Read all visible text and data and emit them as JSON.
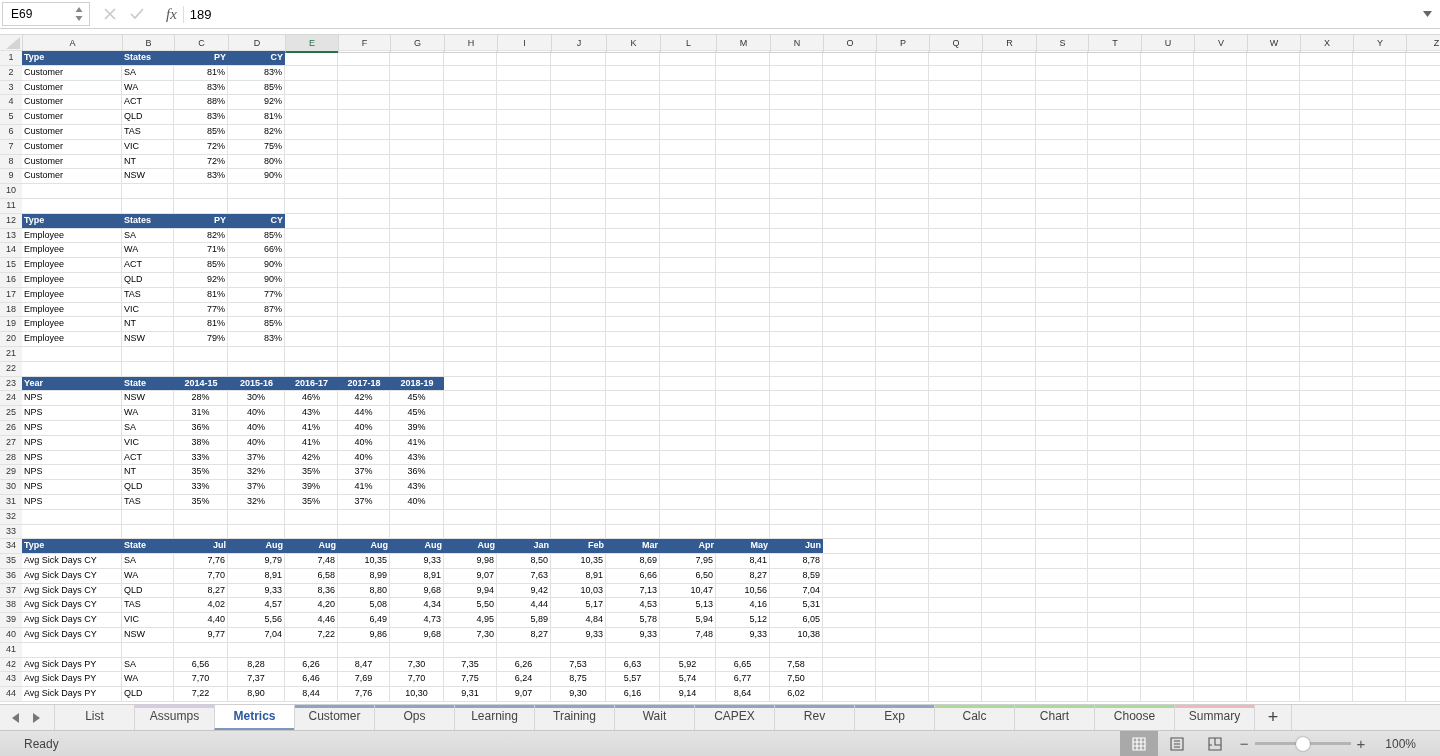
{
  "formula_bar": {
    "name_box": "E69",
    "function_label": "fx",
    "formula": "189"
  },
  "columns": [
    {
      "label": "A",
      "selected": false
    },
    {
      "label": "B",
      "selected": false
    },
    {
      "label": "C",
      "selected": false
    },
    {
      "label": "D",
      "selected": false
    },
    {
      "label": "E",
      "selected": true
    },
    {
      "label": "F",
      "selected": false
    },
    {
      "label": "G",
      "selected": false
    },
    {
      "label": "H",
      "selected": false
    },
    {
      "label": "I",
      "selected": false
    },
    {
      "label": "J",
      "selected": false
    },
    {
      "label": "K",
      "selected": false
    },
    {
      "label": "L",
      "selected": false
    },
    {
      "label": "M",
      "selected": false
    },
    {
      "label": "N",
      "selected": false
    },
    {
      "label": "O",
      "selected": false
    },
    {
      "label": "P",
      "selected": false
    },
    {
      "label": "Q",
      "selected": false
    },
    {
      "label": "R",
      "selected": false
    },
    {
      "label": "S",
      "selected": false
    },
    {
      "label": "T",
      "selected": false
    },
    {
      "label": "U",
      "selected": false
    },
    {
      "label": "V",
      "selected": false
    },
    {
      "label": "W",
      "selected": false
    },
    {
      "label": "X",
      "selected": false
    },
    {
      "label": "Y",
      "selected": false
    },
    {
      "label": "Z",
      "selected": false
    }
  ],
  "rows": [
    {
      "number": "1",
      "kind": "header",
      "cells": [
        "Type",
        "States",
        "PY",
        "CY"
      ]
    },
    {
      "number": "2",
      "kind": "data",
      "cells": [
        "Customer",
        "SA",
        "81%",
        "83%"
      ]
    },
    {
      "number": "3",
      "kind": "data",
      "cells": [
        "Customer",
        "WA",
        "83%",
        "85%"
      ]
    },
    {
      "number": "4",
      "kind": "data",
      "cells": [
        "Customer",
        "ACT",
        "88%",
        "92%"
      ]
    },
    {
      "number": "5",
      "kind": "data",
      "cells": [
        "Customer",
        "QLD",
        "83%",
        "81%"
      ]
    },
    {
      "number": "6",
      "kind": "data",
      "cells": [
        "Customer",
        "TAS",
        "85%",
        "82%"
      ]
    },
    {
      "number": "7",
      "kind": "data",
      "cells": [
        "Customer",
        "VIC",
        "72%",
        "75%"
      ]
    },
    {
      "number": "8",
      "kind": "data",
      "cells": [
        "Customer",
        "NT",
        "72%",
        "80%"
      ]
    },
    {
      "number": "9",
      "kind": "data",
      "cells": [
        "Customer",
        "NSW",
        "83%",
        "90%"
      ]
    },
    {
      "number": "10",
      "cells": []
    },
    {
      "number": "11",
      "cells": []
    },
    {
      "number": "12",
      "kind": "header",
      "cells": [
        "Type",
        "States",
        "PY",
        "CY"
      ]
    },
    {
      "number": "13",
      "kind": "data",
      "cells": [
        "Employee",
        "SA",
        "82%",
        "85%"
      ]
    },
    {
      "number": "14",
      "kind": "data",
      "cells": [
        "Employee",
        "WA",
        "71%",
        "66%"
      ]
    },
    {
      "number": "15",
      "kind": "data",
      "cells": [
        "Employee",
        "ACT",
        "85%",
        "90%"
      ]
    },
    {
      "number": "16",
      "kind": "data",
      "cells": [
        "Employee",
        "QLD",
        "92%",
        "90%"
      ]
    },
    {
      "number": "17",
      "kind": "data",
      "cells": [
        "Employee",
        "TAS",
        "81%",
        "77%"
      ]
    },
    {
      "number": "18",
      "kind": "data",
      "cells": [
        "Employee",
        "VIC",
        "77%",
        "87%"
      ]
    },
    {
      "number": "19",
      "kind": "data",
      "cells": [
        "Employee",
        "NT",
        "81%",
        "85%"
      ]
    },
    {
      "number": "20",
      "kind": "data",
      "cells": [
        "Employee",
        "NSW",
        "79%",
        "83%"
      ]
    },
    {
      "number": "21",
      "cells": []
    },
    {
      "number": "22",
      "cells": []
    },
    {
      "number": "23",
      "kind": "header-centered",
      "cells": [
        "Year",
        "State",
        "2014-15",
        "2015-16",
        "2016-17",
        "2017-18",
        "2018-19"
      ]
    },
    {
      "number": "24",
      "kind": "centered",
      "cells": [
        "NPS",
        "NSW",
        "28%",
        "30%",
        "46%",
        "42%",
        "45%"
      ]
    },
    {
      "number": "25",
      "kind": "centered",
      "cells": [
        "NPS",
        "WA",
        "31%",
        "40%",
        "43%",
        "44%",
        "45%"
      ]
    },
    {
      "number": "26",
      "kind": "centered",
      "cells": [
        "NPS",
        "SA",
        "36%",
        "40%",
        "41%",
        "40%",
        "39%"
      ]
    },
    {
      "number": "27",
      "kind": "centered",
      "cells": [
        "NPS",
        "VIC",
        "38%",
        "40%",
        "41%",
        "40%",
        "41%"
      ]
    },
    {
      "number": "28",
      "kind": "centered",
      "cells": [
        "NPS",
        "ACT",
        "33%",
        "37%",
        "42%",
        "40%",
        "43%"
      ]
    },
    {
      "number": "29",
      "kind": "centered",
      "cells": [
        "NPS",
        "NT",
        "35%",
        "32%",
        "35%",
        "37%",
        "36%"
      ]
    },
    {
      "number": "30",
      "kind": "centered",
      "cells": [
        "NPS",
        "QLD",
        "33%",
        "37%",
        "39%",
        "41%",
        "43%"
      ]
    },
    {
      "number": "31",
      "kind": "centered",
      "cells": [
        "NPS",
        "TAS",
        "35%",
        "32%",
        "35%",
        "37%",
        "40%"
      ]
    },
    {
      "number": "32",
      "cells": []
    },
    {
      "number": "33",
      "cells": []
    },
    {
      "number": "34",
      "kind": "header",
      "cells": [
        "Type",
        "State",
        "Jul",
        "Aug",
        "Aug",
        "Aug",
        "Aug",
        "Aug",
        "Jan",
        "Feb",
        "Mar",
        "Apr",
        "May",
        "Jun"
      ]
    },
    {
      "number": "35",
      "kind": "data",
      "cells": [
        "Avg Sick Days CY",
        "SA",
        "7,76",
        "9,79",
        "7,48",
        "10,35",
        "9,33",
        "9,98",
        "8,50",
        "10,35",
        "8,69",
        "7,95",
        "8,41",
        "8,78"
      ]
    },
    {
      "number": "36",
      "kind": "data",
      "cells": [
        "Avg Sick Days CY",
        "WA",
        "7,70",
        "8,91",
        "6,58",
        "8,99",
        "8,91",
        "9,07",
        "7,63",
        "8,91",
        "6,66",
        "6,50",
        "8,27",
        "8,59"
      ]
    },
    {
      "number": "37",
      "kind": "data",
      "cells": [
        "Avg Sick Days CY",
        "QLD",
        "8,27",
        "9,33",
        "8,36",
        "8,80",
        "9,68",
        "9,94",
        "9,42",
        "10,03",
        "7,13",
        "10,47",
        "10,56",
        "7,04"
      ]
    },
    {
      "number": "38",
      "kind": "data",
      "cells": [
        "Avg Sick Days CY",
        "TAS",
        "4,02",
        "4,57",
        "4,20",
        "5,08",
        "4,34",
        "5,50",
        "4,44",
        "5,17",
        "4,53",
        "5,13",
        "4,16",
        "5,31"
      ]
    },
    {
      "number": "39",
      "kind": "data",
      "cells": [
        "Avg Sick Days CY",
        "VIC",
        "4,40",
        "5,56",
        "4,46",
        "6,49",
        "4,73",
        "4,95",
        "5,89",
        "4,84",
        "5,78",
        "5,94",
        "5,12",
        "6,05"
      ]
    },
    {
      "number": "40",
      "kind": "data",
      "cells": [
        "Avg Sick Days CY",
        "NSW",
        "9,77",
        "7,04",
        "7,22",
        "9,86",
        "9,68",
        "7,30",
        "8,27",
        "9,33",
        "9,33",
        "7,48",
        "9,33",
        "10,38"
      ]
    },
    {
      "number": "41",
      "cells": []
    },
    {
      "number": "42",
      "kind": "centered",
      "cells": [
        "Avg Sick Days PY",
        "SA",
        "6,56",
        "8,28",
        "6,26",
        "8,47",
        "7,30",
        "7,35",
        "6,26",
        "7,53",
        "6,63",
        "5,92",
        "6,65",
        "7,58"
      ]
    },
    {
      "number": "43",
      "kind": "centered",
      "cells": [
        "Avg Sick Days PY",
        "WA",
        "7,70",
        "7,37",
        "6,46",
        "7,69",
        "7,70",
        "7,75",
        "6,24",
        "8,75",
        "5,57",
        "5,74",
        "6,77",
        "7,50"
      ]
    },
    {
      "number": "44",
      "kind": "centered",
      "cells": [
        "Avg Sick Days PY",
        "QLD",
        "7,22",
        "8,90",
        "8,44",
        "7,76",
        "10,30",
        "9,31",
        "9,07",
        "9,30",
        "6,16",
        "9,14",
        "8,64",
        "6,02"
      ]
    }
  ],
  "sheet_tabs": [
    {
      "label": "List",
      "selected": false
    },
    {
      "label": "Assumps",
      "selected": false,
      "color": "#dcc8e6"
    },
    {
      "label": "Metrics",
      "selected": true
    },
    {
      "label": "Customer",
      "selected": false,
      "color": "#8ea5c8"
    },
    {
      "label": "Ops",
      "selected": false,
      "color": "#8ea5c8"
    },
    {
      "label": "Learning",
      "selected": false,
      "color": "#8ea5c8"
    },
    {
      "label": "Training",
      "selected": false,
      "color": "#8ea5c8"
    },
    {
      "label": "Wait",
      "selected": false,
      "color": "#8ea5c8"
    },
    {
      "label": "CAPEX",
      "selected": false,
      "color": "#8ea5c8"
    },
    {
      "label": "Rev",
      "selected": false,
      "color": "#8ea5c8"
    },
    {
      "label": "Exp",
      "selected": false,
      "color": "#8ea5c8"
    },
    {
      "label": "Calc",
      "selected": false,
      "color": "#a8dc98"
    },
    {
      "label": "Chart",
      "selected": false,
      "color": "#a8dc98"
    },
    {
      "label": "Choose",
      "selected": false,
      "color": "#a8dc98"
    },
    {
      "label": "Summary",
      "selected": false,
      "color": "#f0b8b8"
    }
  ],
  "add_sheet": "+",
  "status_bar": {
    "status": "Ready",
    "views": [
      {
        "kind": "normal",
        "selected": true
      },
      {
        "kind": "page-layout",
        "selected": false
      },
      {
        "kind": "page-break",
        "selected": false
      }
    ],
    "zoom_out": "−",
    "zoom_in": "+",
    "zoom": {
      "level": 0.5
    },
    "zoom_label": "100%"
  }
}
